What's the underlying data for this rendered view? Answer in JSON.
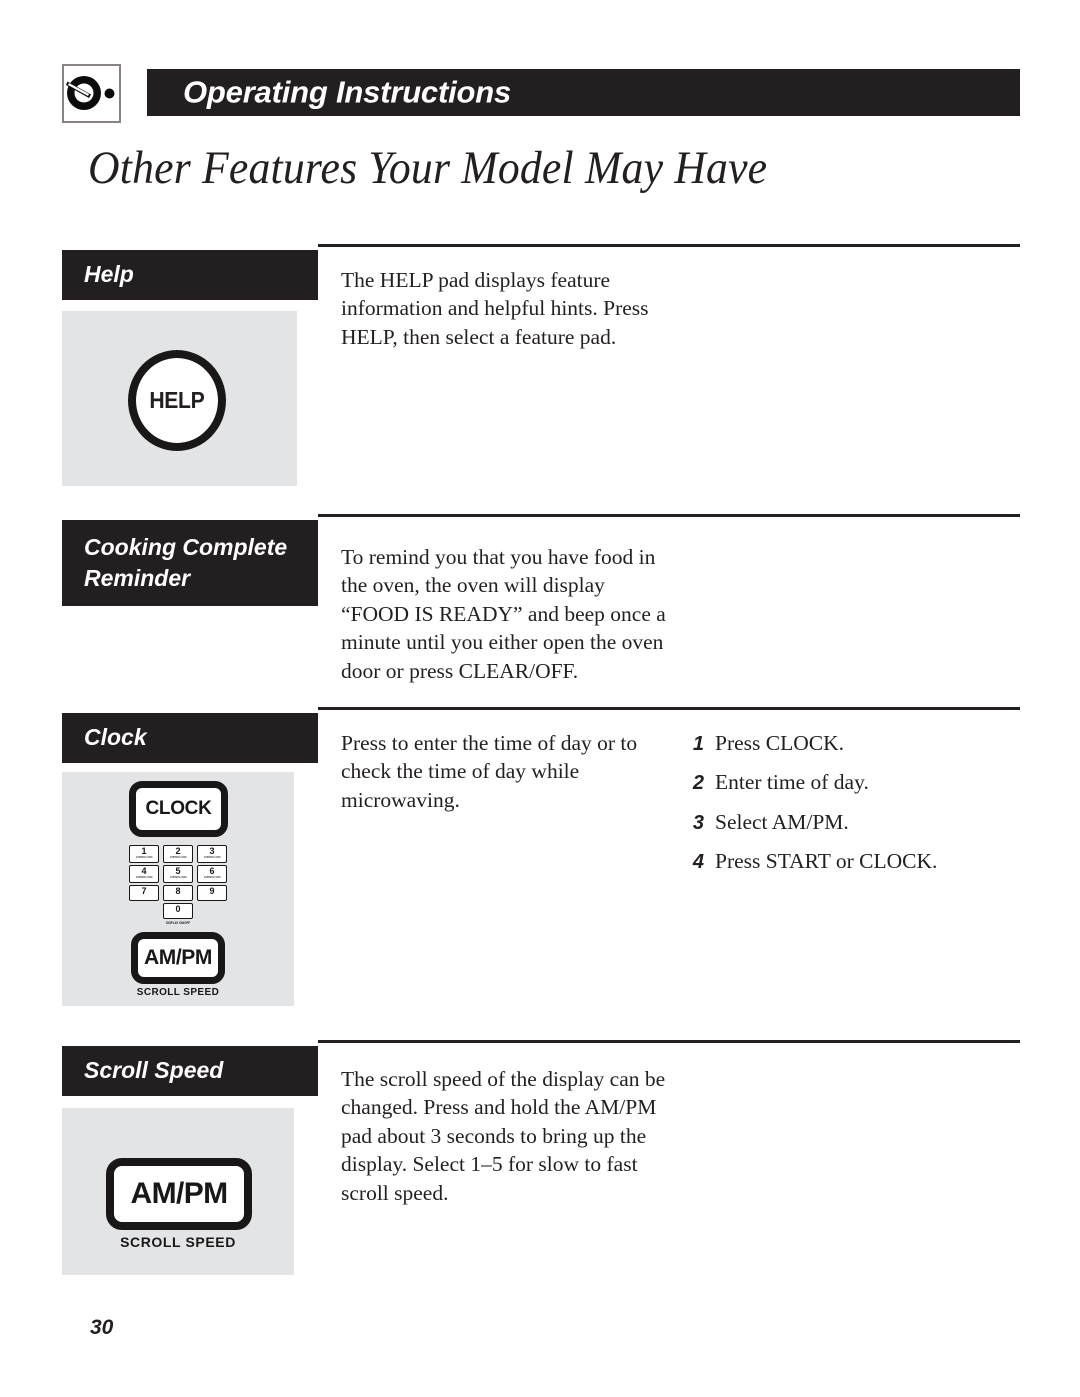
{
  "header": {
    "icon_name": "control-knob-icon",
    "title": "Operating Instructions"
  },
  "page_title": "Other Features Your Model May Have",
  "sections": [
    {
      "id": "help",
      "heading": "Help",
      "body": "The HELP pad displays feature information and helpful hints. Press HELP, then select a feature pad.",
      "figure": {
        "pads": [
          {
            "label": "HELP",
            "shape": "circle"
          }
        ]
      }
    },
    {
      "id": "cooking-complete-reminder",
      "heading_line1": "Cooking Complete",
      "heading_line2": "Reminder",
      "body": "To remind you that you have food in the oven, the oven will display “FOOD IS READY” and beep once a minute until you either open the oven door or press CLEAR/OFF."
    },
    {
      "id": "clock",
      "heading": "Clock",
      "body": "Press to enter the time of day or to check the time of day while microwaving.",
      "steps": [
        {
          "num": "1",
          "text": "Press CLOCK."
        },
        {
          "num": "2",
          "text": "Enter time of day."
        },
        {
          "num": "3",
          "text": "Select AM/PM."
        },
        {
          "num": "4",
          "text": "Press START or CLOCK."
        }
      ],
      "figure": {
        "pads": [
          {
            "label": "CLOCK",
            "shape": "rounded-rect"
          },
          {
            "label": "AM/PM",
            "shape": "rounded-rect",
            "caption": "SCROLL SPEED"
          }
        ],
        "keypad": {
          "rows": [
            [
              {
                "num": "1",
                "sub": "EXPRESS COOK"
              },
              {
                "num": "2",
                "sub": "EXPRESS COOK"
              },
              {
                "num": "3",
                "sub": "EXPRESS COOK"
              }
            ],
            [
              {
                "num": "4",
                "sub": "EXPRESS COOK"
              },
              {
                "num": "5",
                "sub": "EXPRESS COOK"
              },
              {
                "num": "6",
                "sub": "EXPRESS COOK"
              }
            ],
            [
              {
                "num": "7",
                "sub": ""
              },
              {
                "num": "8",
                "sub": ""
              },
              {
                "num": "9",
                "sub": ""
              }
            ]
          ],
          "zero": {
            "num": "0",
            "sub": "DISPLAY ON/OFF"
          }
        }
      }
    },
    {
      "id": "scroll-speed",
      "heading": "Scroll Speed",
      "body": "The scroll speed of the display can be changed. Press and hold the AM/PM pad about 3 seconds to bring up the display. Select 1–5 for slow to fast scroll speed.",
      "figure": {
        "pads": [
          {
            "label": "AM/PM",
            "shape": "rounded-rect",
            "caption": "SCROLL SPEED"
          }
        ]
      }
    }
  ],
  "footer": {
    "page_number": "30"
  },
  "colors": {
    "ink": "#231f20",
    "pad_ink": "#1a1718",
    "figure_background": "#e3e4e6",
    "paper": "#ffffff",
    "icon_border": "#8a8185"
  }
}
